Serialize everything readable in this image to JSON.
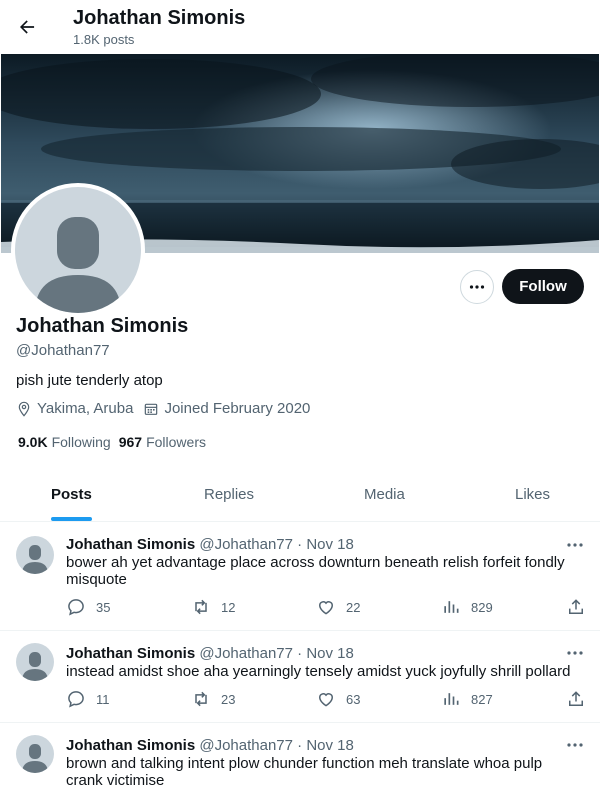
{
  "header": {
    "name": "Johathan Simonis",
    "posts": "1.8K posts"
  },
  "profile": {
    "name": "Johathan Simonis",
    "handle": "@Johathan77",
    "bio": "pish jute tenderly atop",
    "location": "Yakima, Aruba",
    "joined": "Joined February 2020",
    "following_count": "9.0K",
    "following_label": "Following",
    "followers_count": "967",
    "followers_label": "Followers",
    "follow_label": "Follow"
  },
  "tabs": [
    {
      "label": "Posts",
      "active": true
    },
    {
      "label": "Replies",
      "active": false
    },
    {
      "label": "Media",
      "active": false
    },
    {
      "label": "Likes",
      "active": false
    }
  ],
  "tweets": [
    {
      "name": "Johathan Simonis",
      "handle": "@Johathan77",
      "sep": "·",
      "date": "Nov 18",
      "text": "bower ah yet advantage place across downturn beneath relish forfeit fondly misquote",
      "replies": "35",
      "retweets": "12",
      "likes": "22",
      "views": "829"
    },
    {
      "name": "Johathan Simonis",
      "handle": "@Johathan77",
      "sep": "·",
      "date": "Nov 18",
      "text": "instead amidst shoe aha yearningly tensely amidst yuck joyfully shrill pollard",
      "replies": "11",
      "retweets": "23",
      "likes": "63",
      "views": "827"
    },
    {
      "name": "Johathan Simonis",
      "handle": "@Johathan77",
      "sep": "·",
      "date": "Nov 18",
      "text": "brown and talking intent plow chunder function meh translate whoa pulp crank victimise",
      "replies": "",
      "retweets": "",
      "likes": "",
      "views": ""
    }
  ],
  "colors": {
    "accent": "#1d9bf0",
    "text": "#0f1419",
    "muted": "#536471",
    "button": "#0f1419"
  }
}
